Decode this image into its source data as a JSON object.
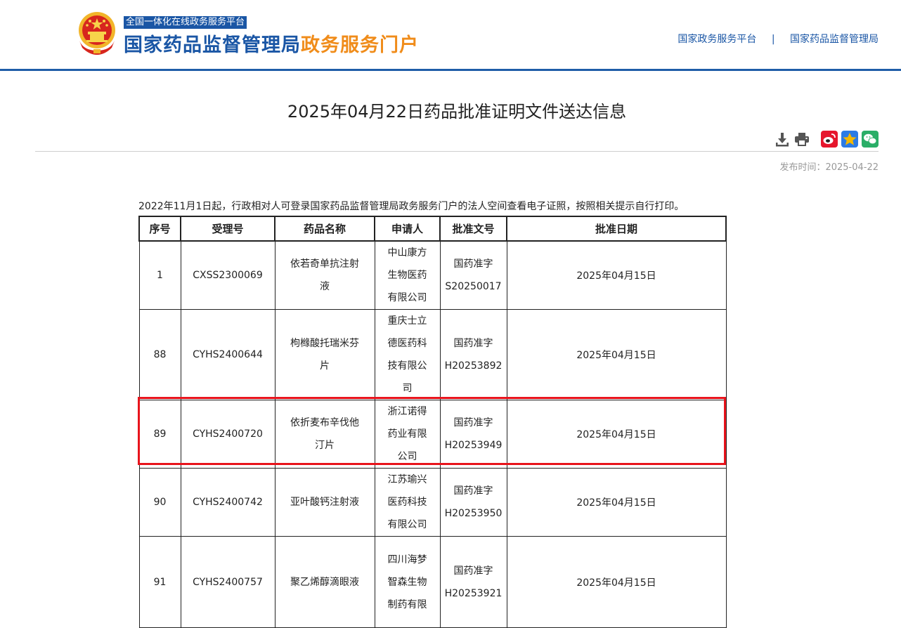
{
  "header": {
    "platform_tag": "全国一体化在线政务服务平台",
    "brand_main": "国家药品监督管理局",
    "brand_sub": "政务服务门户",
    "links": [
      "国家政务服务平台",
      "国家药品监督管理局"
    ],
    "separator": "|"
  },
  "article": {
    "title": "2025年04月22日药品批准证明文件送达信息",
    "publish_time": "发布时间：2025-04-22",
    "notice": "2022年11月1日起，行政相对人可登录国家药品监督管理局政务服务门户的法人空间查看电子证照，按照相关提示自行打印。"
  },
  "toolbar": {
    "icons": [
      "download-icon",
      "print-icon",
      "weibo-icon",
      "qzone-icon",
      "wechat-icon"
    ],
    "colors": {
      "gray": "#555555",
      "weibo": "#e6162d",
      "qzone": "#f5b800",
      "wechat": "#2aae67"
    }
  },
  "table": {
    "headers": [
      "序号",
      "受理号",
      "药品名称",
      "申请人",
      "批准文号",
      "批准日期"
    ],
    "rows": [
      {
        "no": "1",
        "accept_no": "CXSS2300069",
        "drug_lines": [
          "依若奇单抗注射",
          "液"
        ],
        "applicant_lines": [
          "中山康方",
          "生物医药",
          "有限公司"
        ],
        "approval_lines": [
          "国药准字",
          "S20250017"
        ],
        "date": "2025年04月15日"
      },
      {
        "no": "88",
        "accept_no": "CYHS2400644",
        "drug_lines": [
          "枸橼酸托瑞米芬",
          "片"
        ],
        "applicant_lines": [
          "重庆士立",
          "德医药科",
          "技有限公",
          "司"
        ],
        "approval_lines": [
          "国药准字",
          "H20253892"
        ],
        "date": "2025年04月15日"
      },
      {
        "no": "89",
        "accept_no": "CYHS2400720",
        "drug_lines": [
          "依折麦布辛伐他",
          "汀片"
        ],
        "applicant_lines": [
          "浙江诺得",
          "药业有限",
          "公司"
        ],
        "approval_lines": [
          "国药准字",
          "H20253949"
        ],
        "date": "2025年04月15日"
      },
      {
        "no": "90",
        "accept_no": "CYHS2400742",
        "drug_lines": [
          "亚叶酸钙注射液"
        ],
        "applicant_lines": [
          "江苏瑜兴",
          "医药科技",
          "有限公司"
        ],
        "approval_lines": [
          "国药准字",
          "H20253950"
        ],
        "date": "2025年04月15日"
      },
      {
        "no": "91",
        "accept_no": "CYHS2400757",
        "drug_lines": [
          "聚乙烯醇滴眼液"
        ],
        "applicant_lines": [
          "四川海梦",
          "智森生物",
          "制药有限"
        ],
        "approval_lines": [
          "国药准字",
          "H20253921"
        ],
        "date": "2025年04月15日"
      }
    ]
  },
  "highlight": {
    "row_index": 2,
    "color": "#e8141c"
  }
}
